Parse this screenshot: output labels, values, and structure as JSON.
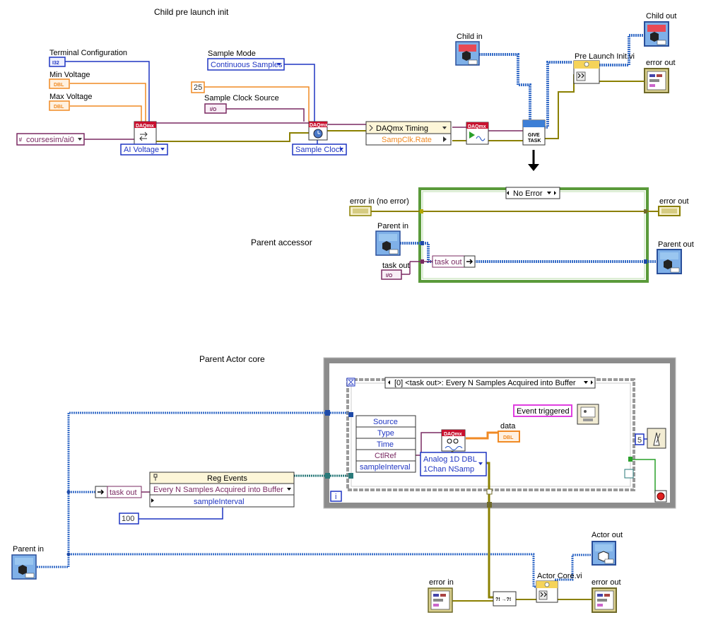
{
  "sections": {
    "child_pre_launch": "Child pre launch init",
    "parent_accessor": "Parent accessor",
    "parent_actor_core": "Parent Actor core"
  },
  "child": {
    "terminal_config_label": "Terminal Configuration",
    "min_voltage_label": "Min Voltage",
    "max_voltage_label": "Max Voltage",
    "sample_mode_label": "Sample Mode",
    "sample_mode_value": "Continuous Samples",
    "sample_clock_source_label": "Sample Clock Source",
    "const_25": "25",
    "channel_value": "coursesim/ai0",
    "ai_voltage": "AI Voltage",
    "sample_clock": "Sample Clock",
    "timing_title": "DAQmx Timing",
    "timing_prop": "SampClk.Rate",
    "give_task": "GIVE TASK",
    "child_in": "Child in",
    "child_out": "Child out",
    "error_out": "error out",
    "pre_launch_vi": "Pre Launch Init.vi",
    "i32": "I32",
    "dbl": "DBL",
    "io": "I/O",
    "daqmx": "DAQmx"
  },
  "accessor": {
    "case_selector": "No Error",
    "error_in": "error in (no error)",
    "error_out": "error out",
    "parent_in": "Parent in",
    "parent_out": "Parent out",
    "task_out": "task out",
    "task_out_node": "task out"
  },
  "actor_core": {
    "event_case": "[0] <task out>: Every N Samples Acquired into Buffer",
    "event_data": [
      "Source",
      "Type",
      "Time",
      "CtlRef",
      "sampleInterval"
    ],
    "event_triggered": "Event triggered",
    "data_label": "data",
    "dbl_array": "DBL",
    "read_mode_line1": "Analog 1D DBL",
    "read_mode_line2": "1Chan NSamp",
    "wait_const": "5",
    "loop_index": "i",
    "reg_events_title": "Reg Events",
    "reg_events_event": "Every N Samples Acquired into Buffer",
    "reg_events_prop": "sampleInterval",
    "task_out": "task out",
    "const_100": "100",
    "parent_in": "Parent in",
    "actor_out": "Actor out",
    "actor_core_vi": "Actor Core.vi",
    "error_in": "error in",
    "error_out": "error out",
    "merge_label": "?! →?!"
  },
  "colors": {
    "class_wire": "#3a6fc8",
    "error_wire": "#8b8000",
    "task_wire": "#7a2a62",
    "numeric_orange": "#f08a24",
    "enum_blue": "#1f35c2",
    "case_green": "#5a9a3a",
    "frame_gray": "#8c8c8c"
  }
}
